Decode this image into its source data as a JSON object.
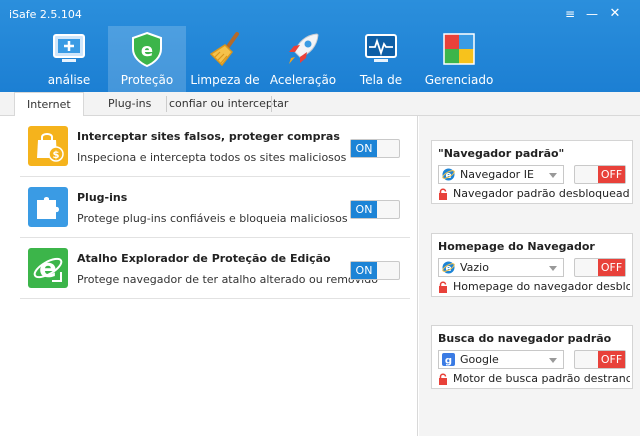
{
  "window": {
    "title": "iSafe 2.5.104",
    "menu_glyph": "≡",
    "min_glyph": "—",
    "close_glyph": "✕"
  },
  "nav": {
    "items": [
      {
        "label": "análise",
        "icon": "monitor-icon"
      },
      {
        "label": "Proteção",
        "icon": "shield-e-icon",
        "active": true
      },
      {
        "label": "Limpeza de",
        "icon": "broom-icon"
      },
      {
        "label": "Aceleração",
        "icon": "rocket-icon"
      },
      {
        "label": "Tela de",
        "icon": "pulse-monitor-icon"
      },
      {
        "label": "Gerenciado",
        "icon": "app-grid-icon"
      }
    ]
  },
  "subtabs": {
    "items": [
      "Internet",
      "Plug-ins",
      "confiar ou interceptar"
    ],
    "active": "Internet"
  },
  "features": [
    {
      "title": "Interceptar sites falsos, proteger compras",
      "desc": "Inspeciona e intercepta todos os sites maliciosos",
      "toggle": "ON",
      "icon": "shopping-bag-icon"
    },
    {
      "title": "Plug-ins",
      "desc": "Protege plug-ins confiáveis e bloqueia maliciosos",
      "toggle": "ON",
      "icon": "puzzle-icon"
    },
    {
      "title": "Atalho Explorador de Proteção de Edição",
      "desc": "Protege navegador de ter atalho alterado ou removido",
      "toggle": "ON",
      "icon": "ie-shortcut-icon"
    }
  ],
  "cards": [
    {
      "title": "\"Navegador padrão\"",
      "select": "Navegador IE",
      "select_icon": "ie-icon",
      "toggle": "OFF",
      "status": "Navegador padrão desbloqueado"
    },
    {
      "title": "Homepage do Navegador",
      "select": "Vazio",
      "select_icon": "ie-icon",
      "toggle": "OFF",
      "status": "Homepage do navegador desbloqueado"
    },
    {
      "title": "Busca do navegador padrão",
      "select": "Google",
      "select_icon": "google-icon",
      "toggle": "OFF",
      "status": "Motor de busca padrão destrancado"
    }
  ],
  "colors": {
    "header": "#1c7fd3",
    "on": "#1d84d6",
    "off": "#e8413a"
  }
}
